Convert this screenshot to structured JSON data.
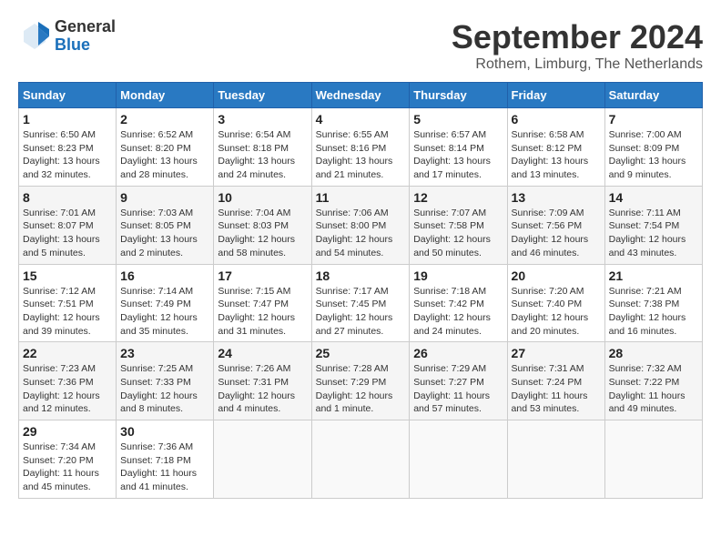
{
  "header": {
    "logo_general": "General",
    "logo_blue": "Blue",
    "month_title": "September 2024",
    "location": "Rothem, Limburg, The Netherlands"
  },
  "weekdays": [
    "Sunday",
    "Monday",
    "Tuesday",
    "Wednesday",
    "Thursday",
    "Friday",
    "Saturday"
  ],
  "weeks": [
    [
      {
        "day": 1,
        "sunrise": "Sunrise: 6:50 AM",
        "sunset": "Sunset: 8:23 PM",
        "daylight": "Daylight: 13 hours and 32 minutes."
      },
      {
        "day": 2,
        "sunrise": "Sunrise: 6:52 AM",
        "sunset": "Sunset: 8:20 PM",
        "daylight": "Daylight: 13 hours and 28 minutes."
      },
      {
        "day": 3,
        "sunrise": "Sunrise: 6:54 AM",
        "sunset": "Sunset: 8:18 PM",
        "daylight": "Daylight: 13 hours and 24 minutes."
      },
      {
        "day": 4,
        "sunrise": "Sunrise: 6:55 AM",
        "sunset": "Sunset: 8:16 PM",
        "daylight": "Daylight: 13 hours and 21 minutes."
      },
      {
        "day": 5,
        "sunrise": "Sunrise: 6:57 AM",
        "sunset": "Sunset: 8:14 PM",
        "daylight": "Daylight: 13 hours and 17 minutes."
      },
      {
        "day": 6,
        "sunrise": "Sunrise: 6:58 AM",
        "sunset": "Sunset: 8:12 PM",
        "daylight": "Daylight: 13 hours and 13 minutes."
      },
      {
        "day": 7,
        "sunrise": "Sunrise: 7:00 AM",
        "sunset": "Sunset: 8:09 PM",
        "daylight": "Daylight: 13 hours and 9 minutes."
      }
    ],
    [
      {
        "day": 8,
        "sunrise": "Sunrise: 7:01 AM",
        "sunset": "Sunset: 8:07 PM",
        "daylight": "Daylight: 13 hours and 5 minutes."
      },
      {
        "day": 9,
        "sunrise": "Sunrise: 7:03 AM",
        "sunset": "Sunset: 8:05 PM",
        "daylight": "Daylight: 13 hours and 2 minutes."
      },
      {
        "day": 10,
        "sunrise": "Sunrise: 7:04 AM",
        "sunset": "Sunset: 8:03 PM",
        "daylight": "Daylight: 12 hours and 58 minutes."
      },
      {
        "day": 11,
        "sunrise": "Sunrise: 7:06 AM",
        "sunset": "Sunset: 8:00 PM",
        "daylight": "Daylight: 12 hours and 54 minutes."
      },
      {
        "day": 12,
        "sunrise": "Sunrise: 7:07 AM",
        "sunset": "Sunset: 7:58 PM",
        "daylight": "Daylight: 12 hours and 50 minutes."
      },
      {
        "day": 13,
        "sunrise": "Sunrise: 7:09 AM",
        "sunset": "Sunset: 7:56 PM",
        "daylight": "Daylight: 12 hours and 46 minutes."
      },
      {
        "day": 14,
        "sunrise": "Sunrise: 7:11 AM",
        "sunset": "Sunset: 7:54 PM",
        "daylight": "Daylight: 12 hours and 43 minutes."
      }
    ],
    [
      {
        "day": 15,
        "sunrise": "Sunrise: 7:12 AM",
        "sunset": "Sunset: 7:51 PM",
        "daylight": "Daylight: 12 hours and 39 minutes."
      },
      {
        "day": 16,
        "sunrise": "Sunrise: 7:14 AM",
        "sunset": "Sunset: 7:49 PM",
        "daylight": "Daylight: 12 hours and 35 minutes."
      },
      {
        "day": 17,
        "sunrise": "Sunrise: 7:15 AM",
        "sunset": "Sunset: 7:47 PM",
        "daylight": "Daylight: 12 hours and 31 minutes."
      },
      {
        "day": 18,
        "sunrise": "Sunrise: 7:17 AM",
        "sunset": "Sunset: 7:45 PM",
        "daylight": "Daylight: 12 hours and 27 minutes."
      },
      {
        "day": 19,
        "sunrise": "Sunrise: 7:18 AM",
        "sunset": "Sunset: 7:42 PM",
        "daylight": "Daylight: 12 hours and 24 minutes."
      },
      {
        "day": 20,
        "sunrise": "Sunrise: 7:20 AM",
        "sunset": "Sunset: 7:40 PM",
        "daylight": "Daylight: 12 hours and 20 minutes."
      },
      {
        "day": 21,
        "sunrise": "Sunrise: 7:21 AM",
        "sunset": "Sunset: 7:38 PM",
        "daylight": "Daylight: 12 hours and 16 minutes."
      }
    ],
    [
      {
        "day": 22,
        "sunrise": "Sunrise: 7:23 AM",
        "sunset": "Sunset: 7:36 PM",
        "daylight": "Daylight: 12 hours and 12 minutes."
      },
      {
        "day": 23,
        "sunrise": "Sunrise: 7:25 AM",
        "sunset": "Sunset: 7:33 PM",
        "daylight": "Daylight: 12 hours and 8 minutes."
      },
      {
        "day": 24,
        "sunrise": "Sunrise: 7:26 AM",
        "sunset": "Sunset: 7:31 PM",
        "daylight": "Daylight: 12 hours and 4 minutes."
      },
      {
        "day": 25,
        "sunrise": "Sunrise: 7:28 AM",
        "sunset": "Sunset: 7:29 PM",
        "daylight": "Daylight: 12 hours and 1 minute."
      },
      {
        "day": 26,
        "sunrise": "Sunrise: 7:29 AM",
        "sunset": "Sunset: 7:27 PM",
        "daylight": "Daylight: 11 hours and 57 minutes."
      },
      {
        "day": 27,
        "sunrise": "Sunrise: 7:31 AM",
        "sunset": "Sunset: 7:24 PM",
        "daylight": "Daylight: 11 hours and 53 minutes."
      },
      {
        "day": 28,
        "sunrise": "Sunrise: 7:32 AM",
        "sunset": "Sunset: 7:22 PM",
        "daylight": "Daylight: 11 hours and 49 minutes."
      }
    ],
    [
      {
        "day": 29,
        "sunrise": "Sunrise: 7:34 AM",
        "sunset": "Sunset: 7:20 PM",
        "daylight": "Daylight: 11 hours and 45 minutes."
      },
      {
        "day": 30,
        "sunrise": "Sunrise: 7:36 AM",
        "sunset": "Sunset: 7:18 PM",
        "daylight": "Daylight: 11 hours and 41 minutes."
      },
      null,
      null,
      null,
      null,
      null
    ]
  ]
}
